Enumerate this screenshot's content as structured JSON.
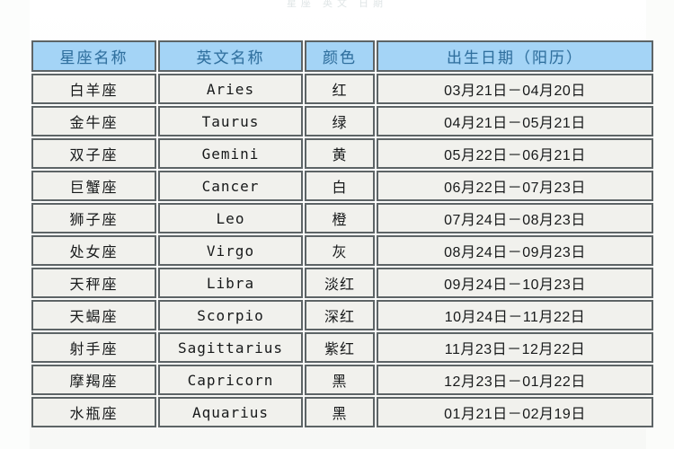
{
  "ghost_text": "星座  英文  日期",
  "colors": {
    "header_bg": "#a4d4f6",
    "header_text": "#2f6f9e",
    "cell_bg": "#f1f1ed",
    "cell_text": "#17191a",
    "border": "#5d6466",
    "page_bg": "#ffffff"
  },
  "table": {
    "headers": [
      "星座名称",
      "英文名称",
      "颜色",
      "出生日期（阳历）"
    ],
    "rows": [
      {
        "name": "白羊座",
        "english": "Aries",
        "color": "红",
        "date": "03月21日－04月20日"
      },
      {
        "name": "金牛座",
        "english": "Taurus",
        "color": "绿",
        "date": "04月21日－05月21日"
      },
      {
        "name": "双子座",
        "english": "Gemini",
        "color": "黄",
        "date": "05月22日－06月21日"
      },
      {
        "name": "巨蟹座",
        "english": "Cancer",
        "color": "白",
        "date": "06月22日－07月23日"
      },
      {
        "name": "狮子座",
        "english": "Leo",
        "color": "橙",
        "date": "07月24日－08月23日"
      },
      {
        "name": "处女座",
        "english": "Virgo",
        "color": "灰",
        "date": "08月24日－09月23日"
      },
      {
        "name": "天秤座",
        "english": "Libra",
        "color": "淡红",
        "date": "09月24日－10月23日"
      },
      {
        "name": "天蝎座",
        "english": "Scorpio",
        "color": "深红",
        "date": "10月24日－11月22日"
      },
      {
        "name": "射手座",
        "english": "Sagittarius",
        "color": "紫红",
        "date": "11月23日－12月22日"
      },
      {
        "name": "摩羯座",
        "english": "Capricorn",
        "color": "黑",
        "date": "12月23日－01月22日"
      },
      {
        "name": "水瓶座",
        "english": "Aquarius",
        "color": "黑",
        "date": "01月21日－02月19日"
      }
    ]
  }
}
